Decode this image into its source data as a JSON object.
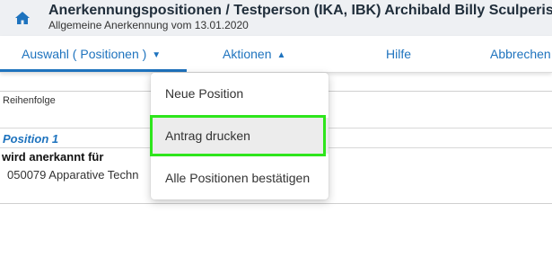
{
  "header": {
    "icon": "home-icon",
    "title": "Anerkennungspositionen  / Testperson (IKA, IBK) Archibald Billy Sculperist",
    "subtitle": "Allgemeine Anerkennung vom 13.01.2020"
  },
  "nav": {
    "items": [
      {
        "label": "Auswahl ( Positionen )",
        "caret": "▼",
        "active": true
      },
      {
        "label": "Aktionen",
        "caret": "▲",
        "active": false
      },
      {
        "label": "Hilfe"
      },
      {
        "label": "Abbrechen"
      }
    ]
  },
  "content": {
    "column_header": "Reihenfolge",
    "position_label": "Position 1",
    "recognized_label": "wird anerkannt für",
    "course": "050079 Apparative Techn"
  },
  "dropdown": {
    "items": [
      {
        "label": "Neue Position"
      },
      {
        "label": "Antrag drucken",
        "hovered": true
      },
      {
        "label": "Alle Positionen bestätigen"
      }
    ]
  },
  "colors": {
    "accent": "#1e73be",
    "highlight": "#2ee51c",
    "header_bg": "#eef0f3"
  }
}
